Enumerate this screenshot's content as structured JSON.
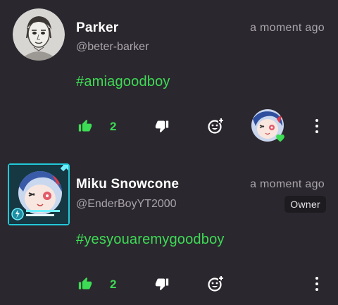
{
  "comments": [
    {
      "name": "Parker",
      "handle": "@beter-barker",
      "time": "a moment ago",
      "text": "#amiagoodboy",
      "likes": "2",
      "icons": {
        "avatar": "sketch-portrait-avatar",
        "like": "thumbs-up-icon",
        "dislike": "thumbs-down-icon",
        "react": "add-reaction-icon",
        "more": "kebab-menu-icon",
        "reactor": "reactor-avatar-with-heart"
      }
    },
    {
      "name": "Miku Snowcone",
      "handle": "@EnderBoyYT2000",
      "time": "a moment ago",
      "badge": "Owner",
      "text": "#yesyouaremygoodboy",
      "likes": "2",
      "icons": {
        "avatar": "anime-avatar-with-cyan-frame",
        "like": "thumbs-up-icon",
        "dislike": "thumbs-down-icon",
        "react": "add-reaction-icon",
        "more": "kebab-menu-icon"
      }
    }
  ],
  "colors": {
    "background": "#2b272e",
    "accent_green": "#3ddc55",
    "muted_text": "#a9a5ab",
    "frame_cyan": "#21c9d8"
  }
}
